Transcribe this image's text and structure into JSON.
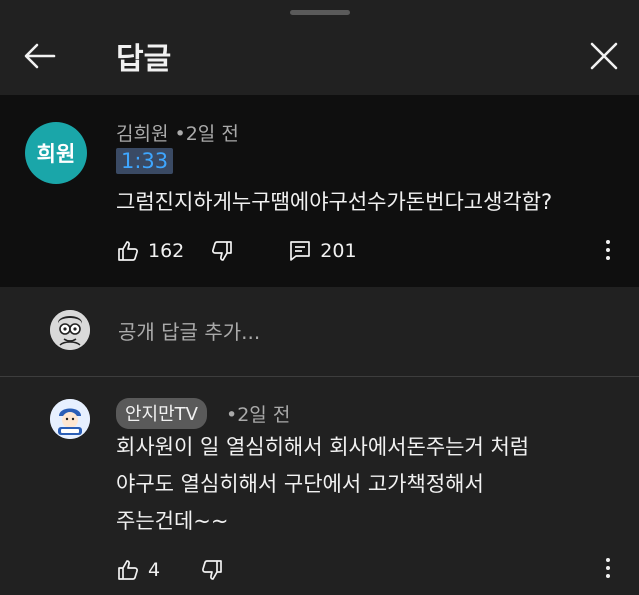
{
  "header": {
    "title": "답글",
    "back_icon": "arrow-left-icon",
    "close_icon": "close-icon"
  },
  "comment": {
    "avatar_text": "희원",
    "avatar_color": "#1aa6a9",
    "author": "김희원",
    "separator": "•",
    "date": "2일 전",
    "timestamp": "1:33",
    "text": "그럼진지하게누구땜에야구선수가돈번다고생각함?",
    "likes": "162",
    "replies": "201"
  },
  "add_reply": {
    "placeholder": "공개 답글 추가..."
  },
  "reply": {
    "channel": "안지만TV",
    "separator": "•",
    "date": "2일 전",
    "lines": [
      "회사원이 일 열심히해서 회사에서돈주는거 처럼",
      "야구도 열심히해서 구단에서 고가책정해서",
      "주는건데~~"
    ],
    "likes": "4"
  },
  "colors": {
    "background": "#212121",
    "highlight_background": "#0f0f0f",
    "link": "#3ea6ff",
    "secondary_text": "#aaaaaa"
  }
}
